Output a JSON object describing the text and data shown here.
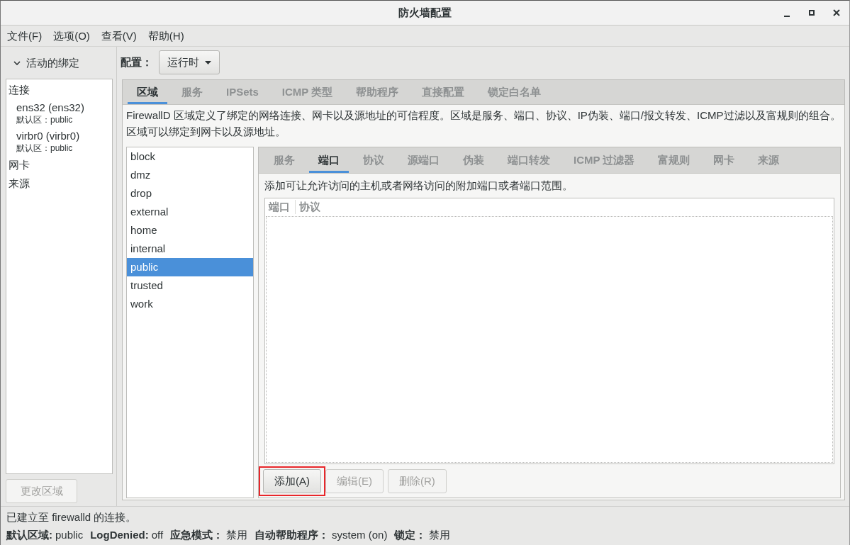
{
  "window": {
    "title": "防火墙配置"
  },
  "menu": [
    {
      "label": "文件(F)"
    },
    {
      "label": "选项(O)"
    },
    {
      "label": "查看(V)"
    },
    {
      "label": "帮助(H)"
    }
  ],
  "bindings": {
    "title": "活动的绑定",
    "expanded": true,
    "items": [
      {
        "label": "连接",
        "children": [
          {
            "label": "ens32 (ens32)",
            "detail": "默认区：public"
          },
          {
            "label": "virbr0 (virbr0)",
            "detail": "默认区：public"
          }
        ]
      },
      {
        "label": "网卡"
      },
      {
        "label": "来源"
      }
    ],
    "button": {
      "label": "更改区域",
      "disabled": true
    }
  },
  "configuration": {
    "label": "配置：",
    "value": "运行时"
  },
  "tabs": [
    {
      "label": "区域",
      "selected": true
    },
    {
      "label": "服务",
      "selected": false
    },
    {
      "label": "IPSets",
      "selected": false
    },
    {
      "label": "ICMP 类型",
      "selected": false
    },
    {
      "label": "帮助程序",
      "selected": false
    },
    {
      "label": "直接配置",
      "selected": false
    },
    {
      "label": "锁定白名单",
      "selected": false
    }
  ],
  "zone_description": "FirewallD 区域定义了绑定的网络连接、网卡以及源地址的可信程度。区域是服务、端口、协议、IP伪装、端口/报文转发、ICMP过滤以及富规则的组合。区域可以绑定到网卡以及源地址。",
  "zones": [
    {
      "label": "block",
      "selected": false
    },
    {
      "label": "dmz",
      "selected": false
    },
    {
      "label": "drop",
      "selected": false
    },
    {
      "label": "external",
      "selected": false
    },
    {
      "label": "home",
      "selected": false
    },
    {
      "label": "internal",
      "selected": false
    },
    {
      "label": "public",
      "selected": true
    },
    {
      "label": "trusted",
      "selected": false
    },
    {
      "label": "work",
      "selected": false
    }
  ],
  "zone_tabs": [
    {
      "label": "服务",
      "selected": false
    },
    {
      "label": "端口",
      "selected": true
    },
    {
      "label": "协议",
      "selected": false
    },
    {
      "label": "源端口",
      "selected": false
    },
    {
      "label": "伪装",
      "selected": false
    },
    {
      "label": "端口转发",
      "selected": false
    },
    {
      "label": "ICMP 过滤器",
      "selected": false
    },
    {
      "label": "富规则",
      "selected": false
    },
    {
      "label": "网卡",
      "selected": false
    },
    {
      "label": "来源",
      "selected": false
    }
  ],
  "ports": {
    "description": "添加可让允许访问的主机或者网络访问的附加端口或者端口范围。",
    "columns": [
      "端口",
      "协议"
    ],
    "buttons": [
      {
        "label": "添加(A)",
        "disabled": false,
        "highlighted": true
      },
      {
        "label": "编辑(E)",
        "disabled": true,
        "highlighted": false
      },
      {
        "label": "删除(R)",
        "disabled": true,
        "highlighted": false
      }
    ]
  },
  "status_bar": {
    "message": "已建立至 firewalld 的连接。",
    "fields": [
      {
        "label": "默认区域:",
        "value": "public"
      },
      {
        "label": "LogDenied:",
        "value": "off"
      },
      {
        "label": "应急模式：",
        "value": "禁用"
      },
      {
        "label": "自动帮助程序：",
        "value": "system (on)"
      },
      {
        "label": "锁定：",
        "value": "禁用"
      }
    ]
  }
}
